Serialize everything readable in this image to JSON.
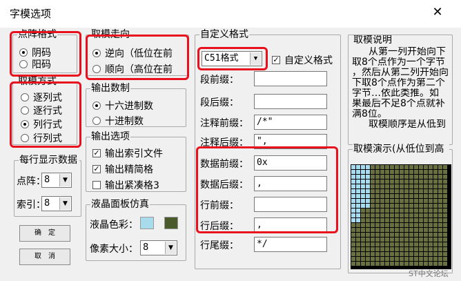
{
  "window": {
    "title": "字模选项",
    "close_glyph": "✕"
  },
  "dot_format": {
    "title": "点阵格式",
    "options": [
      "阴码",
      "阳码"
    ],
    "selected": 0
  },
  "scan_mode": {
    "title": "取模方式",
    "options": [
      "逐列式",
      "逐行式",
      "列行式",
      "行列式"
    ],
    "selected": 2
  },
  "direction": {
    "title": "取模走向",
    "options": [
      "逆向（低位在前",
      "顺向（高位在前"
    ],
    "selected": 0
  },
  "output_base": {
    "title": "输出数制",
    "options": [
      "十六进制数",
      "十进制数"
    ],
    "selected": 0
  },
  "output_opts": {
    "title": "输出选项",
    "items": [
      {
        "label": "输出索引文件",
        "checked": true,
        "mark": "✓"
      },
      {
        "label": "输出精简格",
        "checked": true,
        "mark": "✓"
      },
      {
        "label": "输出紧凑格3",
        "checked": false,
        "mark": ""
      }
    ]
  },
  "per_line": {
    "title": "每行显示数据",
    "dot_label": "点阵：",
    "dot_value": "8",
    "index_label": "索引：",
    "index_value": "8",
    "arrow": "▼"
  },
  "buttons": {
    "confirm": "确　定",
    "cancel": "取　消"
  },
  "lcd": {
    "title": "液晶面板仿真",
    "color_label": "液晶色彩：",
    "pixel_label": "像素大小：",
    "pixel_value": "8",
    "colors": [
      "#a8dcec",
      "#4a5a2a"
    ]
  },
  "custom": {
    "title": "自定义格式",
    "format_value": "C51格式",
    "custom_check_label": "自定义格式",
    "check_mark": "✓",
    "fields": [
      {
        "label": "段前缀：",
        "value": ""
      },
      {
        "label": "段后缀：",
        "value": ""
      },
      {
        "label": "注释前缀：",
        "value": "/*\""
      },
      {
        "label": "注释后缀：",
        "value": "\","
      },
      {
        "label": "数据前缀：",
        "value": "0x"
      },
      {
        "label": "数据后缀：",
        "value": ","
      },
      {
        "label": "行前缀：",
        "value": ""
      },
      {
        "label": "行后缀：",
        "value": ","
      },
      {
        "label": "行尾缀：",
        "value": "*/"
      }
    ]
  },
  "explain": {
    "title": "取模说明",
    "lines": [
      "从第一列开始向下",
      "取8个点作为一个字节",
      "，然后从第二列开始向",
      "下取8个点作为第二个",
      "字节…依此类推。如",
      "果最后不足8个点就补",
      "满8位。",
      "取模顺序是从低到"
    ]
  },
  "demo": {
    "title": "取模演示(从低位到高",
    "on_color": "#a6dcf0",
    "off_color": "#6a7040",
    "bg": "#000000"
  },
  "watermark": "ST中文论坛"
}
